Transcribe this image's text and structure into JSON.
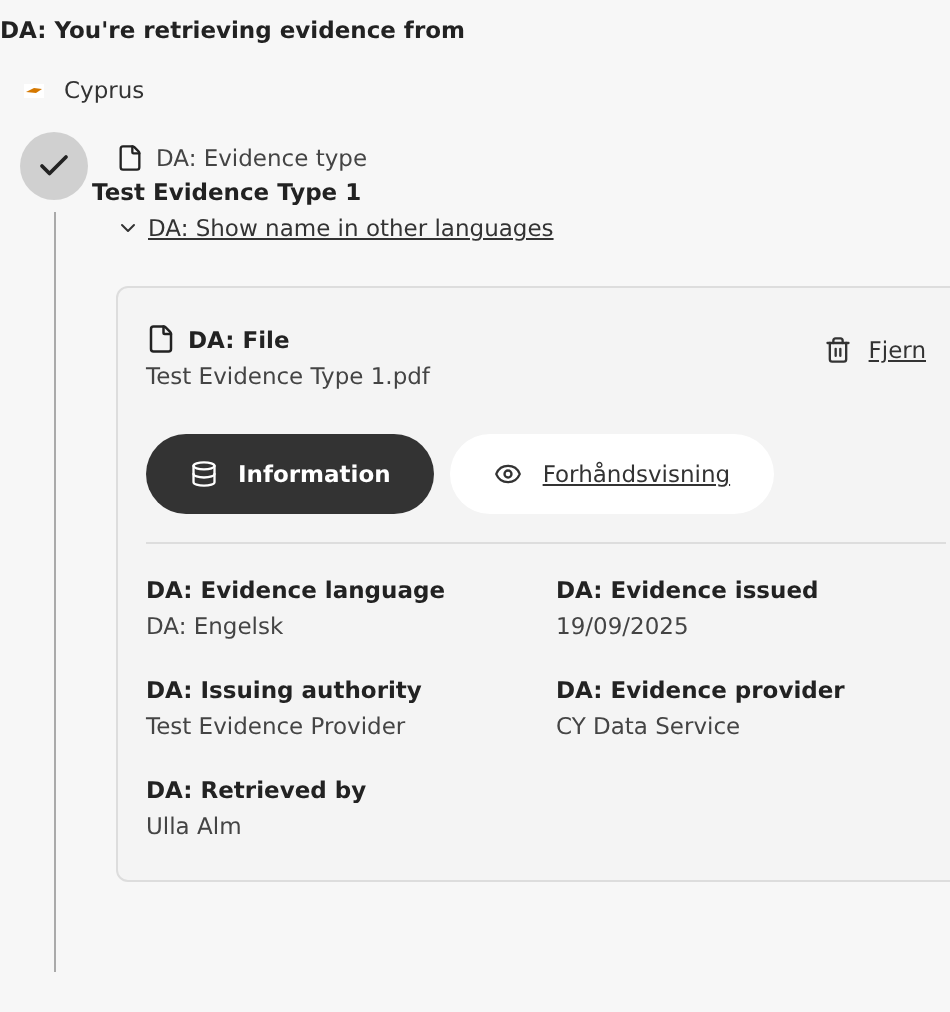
{
  "heading": "DA: You're retrieving evidence from",
  "country": {
    "name": "Cyprus"
  },
  "step": {
    "completed": true,
    "label": "DA: Evidence type",
    "title": "Test Evidence Type 1",
    "toggle": {
      "label": "DA: Show name in other languages",
      "expanded": false
    }
  },
  "file": {
    "label": "DA: File",
    "filename": "Test Evidence Type 1.pdf",
    "remove": "Fjern"
  },
  "tabs": [
    {
      "label": "Information",
      "kind": "database",
      "selected": true
    },
    {
      "label": "Forhåndsvisning",
      "kind": "eye",
      "selected": false
    }
  ],
  "fields": [
    {
      "label": "DA: Evidence language",
      "value": "DA: Engelsk"
    },
    {
      "label": "DA: Evidence issued",
      "value": "19/09/2025"
    },
    {
      "label": "DA: Issuing authority",
      "value": "Test Evidence Provider"
    },
    {
      "label": "DA: Evidence provider",
      "value": "CY Data Service"
    },
    {
      "label": "DA: Retrieved by",
      "value": "Ulla Alm"
    }
  ]
}
